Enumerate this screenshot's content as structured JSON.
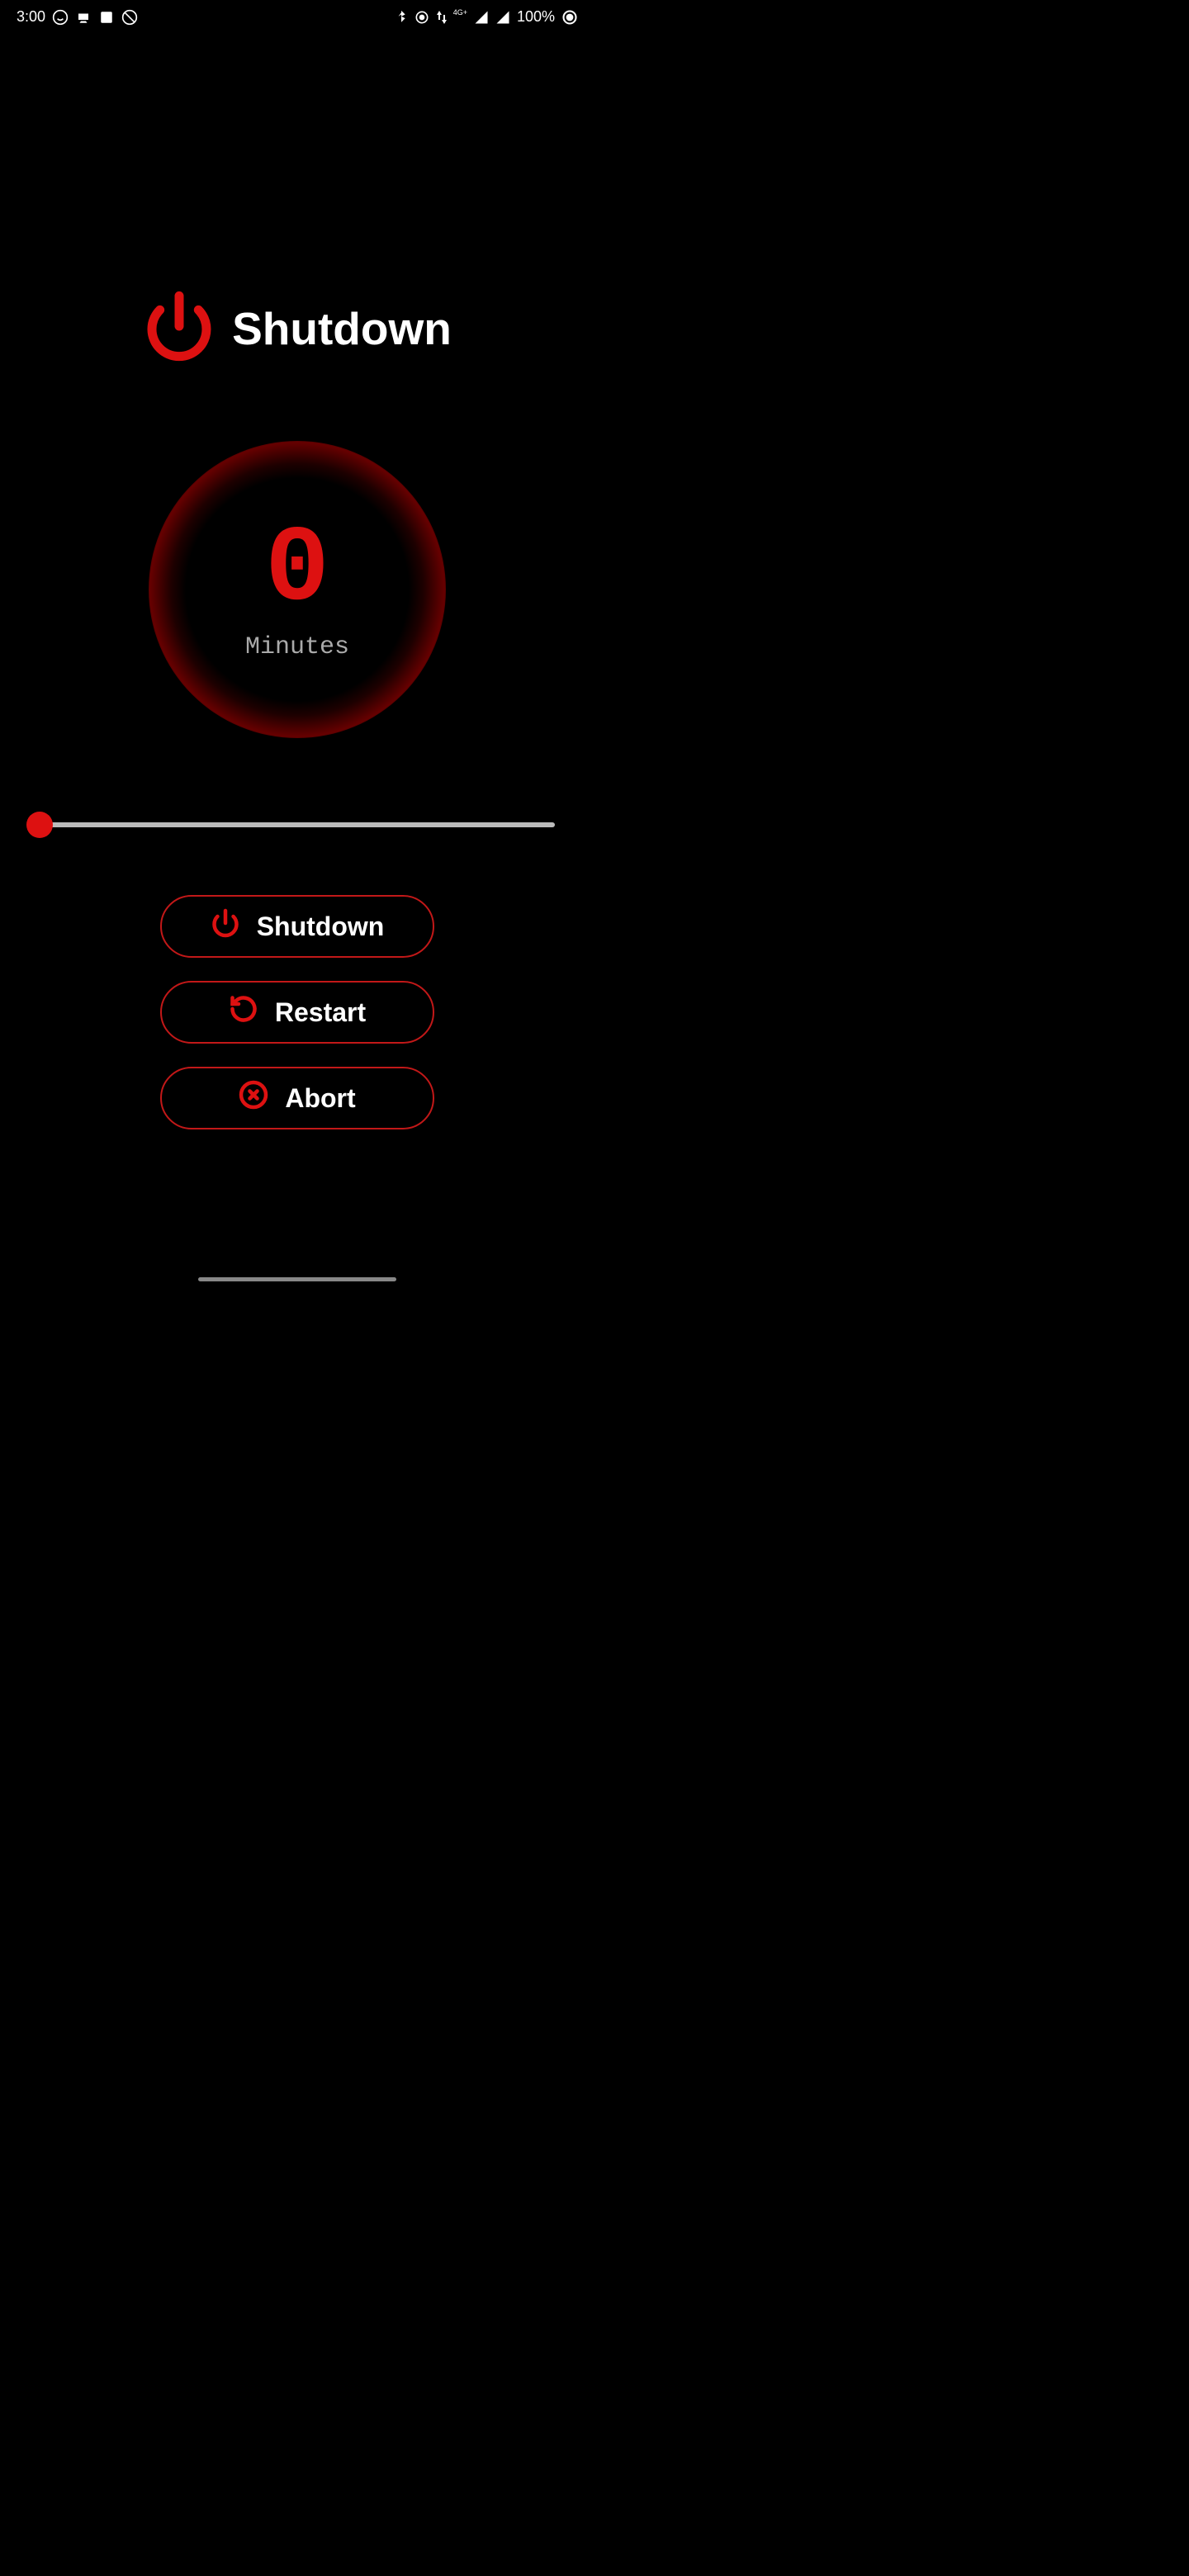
{
  "status": {
    "time": "3:00",
    "network_type": "4G+",
    "battery": "100%"
  },
  "header": {
    "title": "Shutdown"
  },
  "timer": {
    "value": "0",
    "unit": "Minutes"
  },
  "slider": {
    "value": 0,
    "min": 0,
    "max": 100
  },
  "buttons": {
    "shutdown": "Shutdown",
    "restart": "Restart",
    "abort": "Abort"
  }
}
